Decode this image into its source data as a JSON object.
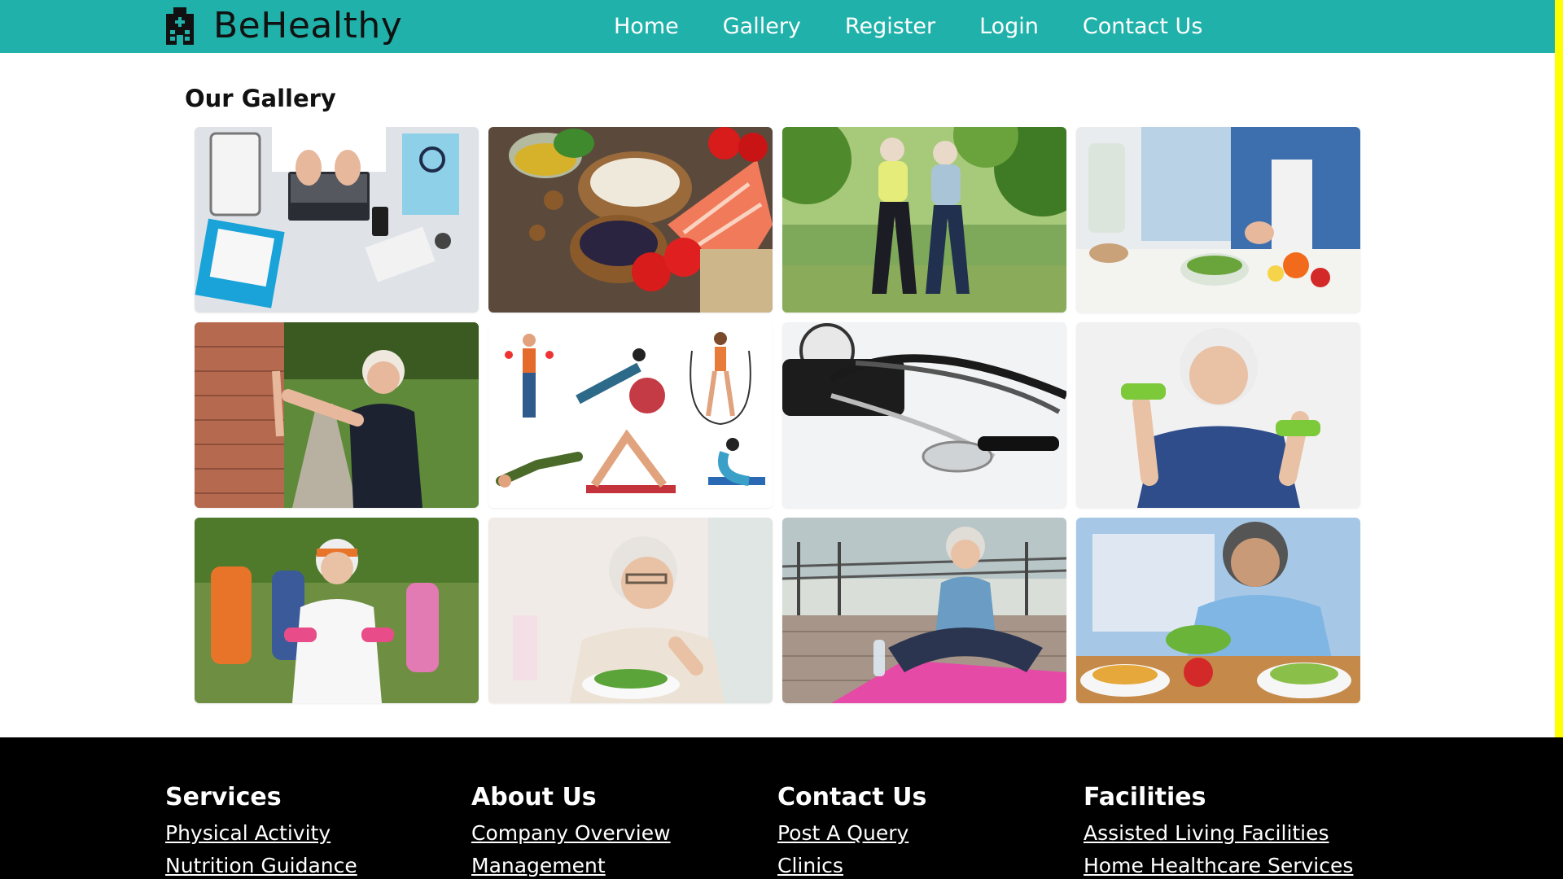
{
  "header": {
    "brand_name": "BeHealthy",
    "brand_icon": "hospital-building-icon",
    "nav": [
      {
        "label": "Home"
      },
      {
        "label": "Gallery"
      },
      {
        "label": "Register"
      },
      {
        "label": "Login"
      },
      {
        "label": "Contact Us"
      }
    ]
  },
  "gallery": {
    "title": "Our Gallery",
    "images": [
      {
        "name": "doctor-desk-laptop-photo"
      },
      {
        "name": "healthy-food-salmon-photo"
      },
      {
        "name": "seniors-walking-park-photo"
      },
      {
        "name": "couple-cooking-salad-photo"
      },
      {
        "name": "senior-stretching-wall-photo"
      },
      {
        "name": "exercise-illustrations-image"
      },
      {
        "name": "stethoscope-photo"
      },
      {
        "name": "senior-dumbbells-photo"
      },
      {
        "name": "senior-group-exercise-photo"
      },
      {
        "name": "senior-eating-salad-photo"
      },
      {
        "name": "senior-yoga-mat-photo"
      },
      {
        "name": "patient-hospital-meal-photo"
      }
    ]
  },
  "footer": {
    "columns": [
      {
        "heading": "Services",
        "links": [
          "Physical Activity",
          "Nutrition Guidance"
        ]
      },
      {
        "heading": "About Us",
        "links": [
          "Company Overview",
          "Management"
        ]
      },
      {
        "heading": "Contact Us",
        "links": [
          "Post A Query",
          "Clinics"
        ]
      },
      {
        "heading": "Facilities",
        "links": [
          "Assisted Living Facilities",
          "Home Healthcare Services"
        ]
      }
    ]
  },
  "colors": {
    "navbar_bg": "#20b2aa",
    "footer_bg": "#000000",
    "accent_strip": "#ffff00"
  }
}
